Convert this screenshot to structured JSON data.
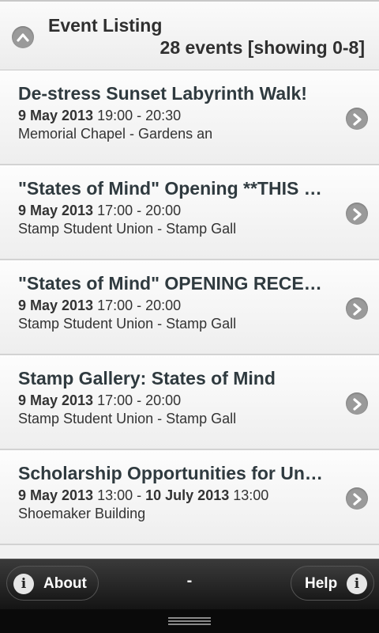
{
  "header": {
    "title": "Event Listing",
    "count": "28 events [showing 0-8]"
  },
  "events": [
    {
      "title": "De-stress Sunset Labyrinth Walk!",
      "start_date": "9 May 2013",
      "start_time": "19:00",
      "sep": " - ",
      "end_date": "",
      "end_time": "20:30",
      "location": "Memorial Chapel - Gardens an"
    },
    {
      "title": "\"States of Mind\" Opening **THIS EVENT",
      "start_date": "9 May 2013",
      "start_time": "17:00",
      "sep": " - ",
      "end_date": "",
      "end_time": "20:00",
      "location": "Stamp Student Union - Stamp Gall"
    },
    {
      "title": "\"States of Mind\" OPENING RECEPTION",
      "start_date": "9 May 2013",
      "start_time": "17:00",
      "sep": " - ",
      "end_date": "",
      "end_time": "20:00",
      "location": "Stamp Student Union - Stamp Gall"
    },
    {
      "title": "Stamp Gallery: States of Mind",
      "start_date": "9 May 2013",
      "start_time": "17:00",
      "sep": " - ",
      "end_date": "",
      "end_time": "20:00",
      "location": "Stamp Student Union - Stamp Gall"
    },
    {
      "title": "Scholarship Opportunities for Undergraduates",
      "start_date": "9 May 2013",
      "start_time": "13:00",
      "sep": " - ",
      "end_date": "10 July 2013",
      "end_time": "13:00",
      "location": "Shoemaker Building"
    }
  ],
  "footer": {
    "about_label": "About",
    "help_label": "Help",
    "center_label": "-",
    "info_glyph": "i"
  },
  "icons": {
    "collapse": "chevron-up-icon",
    "row_arrow": "chevron-right-icon",
    "info": "info-icon"
  }
}
